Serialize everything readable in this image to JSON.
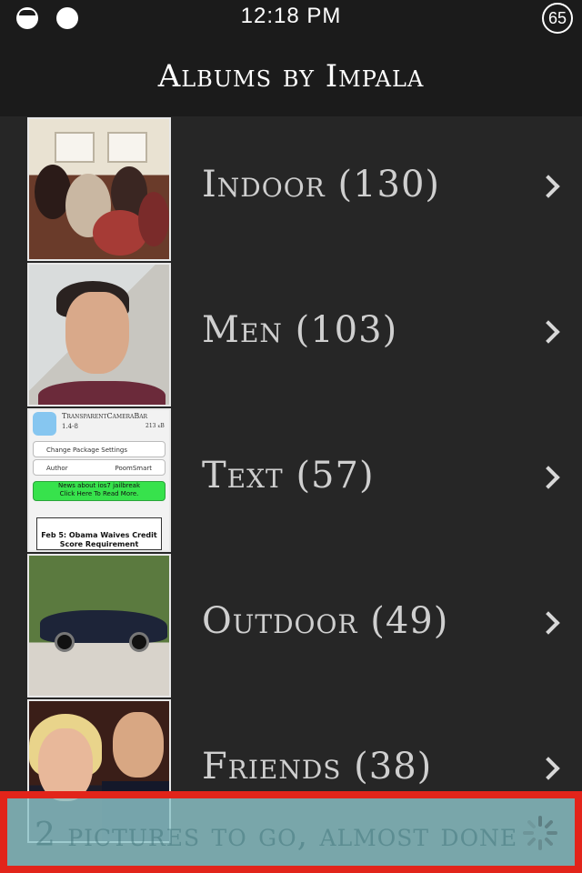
{
  "status_bar": {
    "time": "12:18 PM",
    "battery_badge": "65",
    "icons": [
      "half-circle-icon",
      "circle-icon",
      "battery-circle-icon"
    ]
  },
  "nav": {
    "title": "Albums by Impala"
  },
  "albums": [
    {
      "label": "Indoor (130)",
      "thumb": "indoor-photo"
    },
    {
      "label": "Men (103)",
      "thumb": "man-selfie-photo"
    },
    {
      "label": "Text (57)",
      "thumb": "screenshot-photo"
    },
    {
      "label": "Outdoor (49)",
      "thumb": "car-outdoor-photo"
    },
    {
      "label": "Friends (38)",
      "thumb": "friends-photo"
    }
  ],
  "thumb_text": {
    "app_title": "TransparentCameraBar",
    "version": "1.4-8",
    "size": "213 kB",
    "change_settings": "Change Package Settings",
    "author": "Author",
    "author_name": "PoomSmart",
    "news_line1": "News about ios7 jailbreak",
    "news_line2": "Click Here To Read More.",
    "banner": "Feb 5: Obama Waives Credit Score Requirement"
  },
  "progress": {
    "text": "2 pictures to go, almost done",
    "spinner_icon": "spinner-icon"
  },
  "colors": {
    "background": "#262626",
    "nav_background": "#1b1b1b",
    "banner_border": "#e2241a",
    "banner_fill": "#8cc3c8"
  }
}
